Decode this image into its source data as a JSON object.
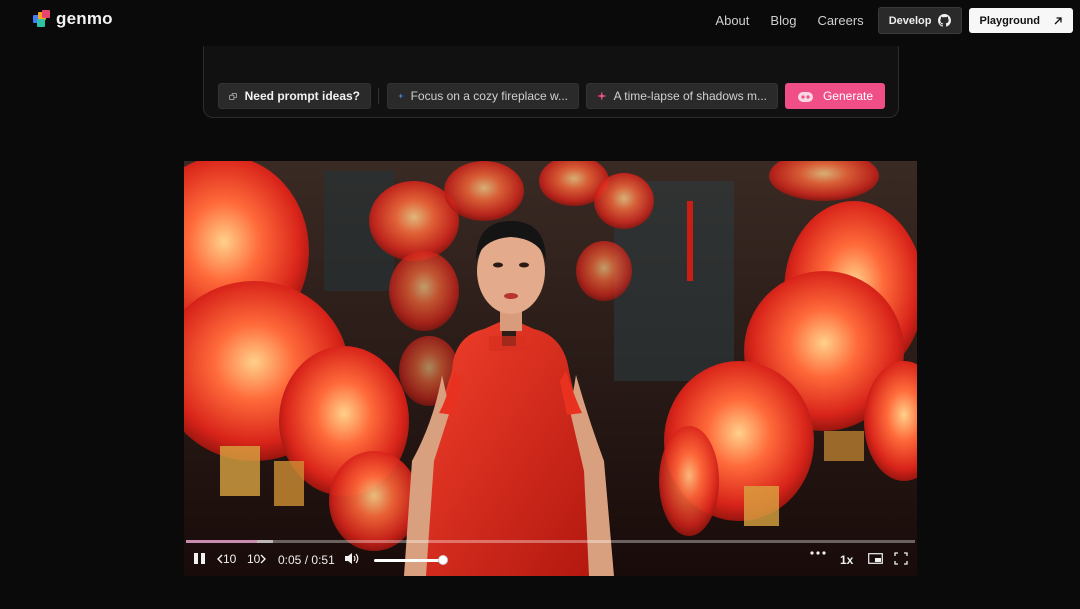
{
  "header": {
    "logo_text": "genmo",
    "nav": [
      "About",
      "Blog",
      "Careers"
    ],
    "develop_label": "Develop",
    "playground_label": "Playground"
  },
  "prompt_bar": {
    "ideas_label": "Need prompt ideas?",
    "suggestion_1": "Focus on a cozy fireplace w...",
    "suggestion_2": "A time-lapse of shadows m...",
    "generate_label": "Generate"
  },
  "player": {
    "rewind_label": "10",
    "forward_label": "10",
    "current_time": "0:05",
    "separator": "/",
    "duration": "0:51",
    "speed": "1x",
    "progress_fraction": 0.098,
    "buffer_fraction": 0.12,
    "volume_fraction": 1.0
  },
  "colors": {
    "accent": "#ef4f86",
    "background": "#0a0a0a"
  },
  "icons": {
    "github": "github-icon",
    "arrow": "arrow-up-right-icon",
    "ideas": "chip-icon",
    "sparkle_blue": "sparkle-icon",
    "sparkle_pink": "sparkle-icon",
    "generate": "robot-icon"
  }
}
